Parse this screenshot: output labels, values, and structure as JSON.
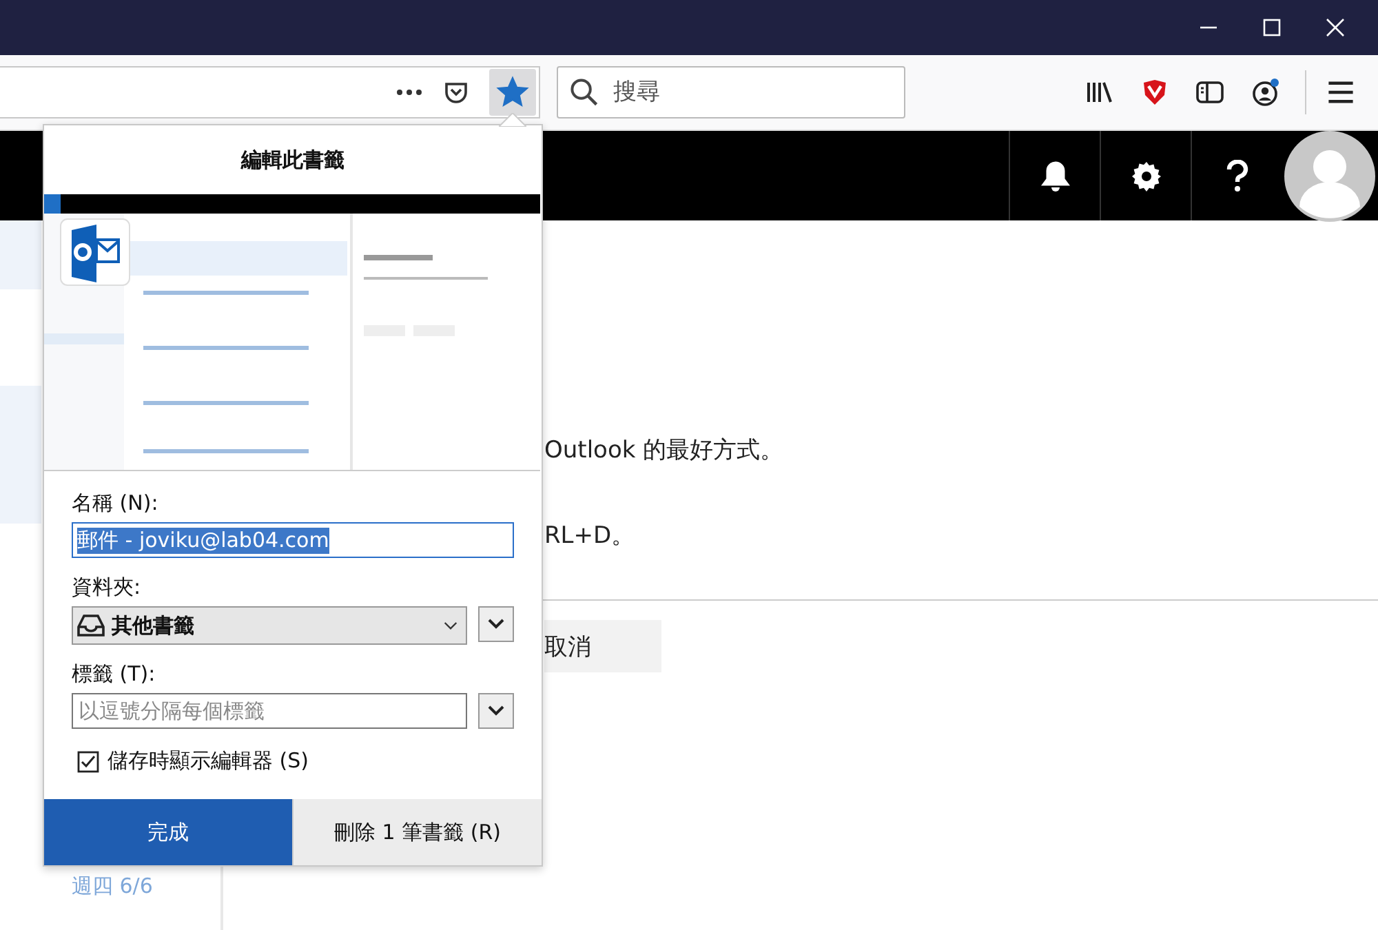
{
  "toolbar": {
    "bookmarked": true,
    "search": {
      "placeholder": "搜尋"
    }
  },
  "page": {
    "header": {
      "notifications": true
    },
    "lines": [
      "Outlook 的最好方式。",
      "RL+D。"
    ],
    "cancel_button": "取消",
    "date": "週四 6/6"
  },
  "bookmark_panel": {
    "title": "編輯此書籤",
    "name": {
      "label": "名稱 (N):",
      "value": "郵件 - joviku@lab04.com",
      "value_selected": true
    },
    "folder": {
      "label": "資料夾:",
      "value": "其他書籤"
    },
    "tags": {
      "label": "標籤 (T):",
      "placeholder": "以逗號分隔每個標籤"
    },
    "show_editor": {
      "label": "儲存時顯示編輯器 (S)",
      "checked": true
    },
    "buttons": [
      {
        "label": "完成",
        "kind": "primary"
      },
      {
        "label": "刪除 1 筆書籤 (R)",
        "kind": "secondary"
      }
    ]
  }
}
